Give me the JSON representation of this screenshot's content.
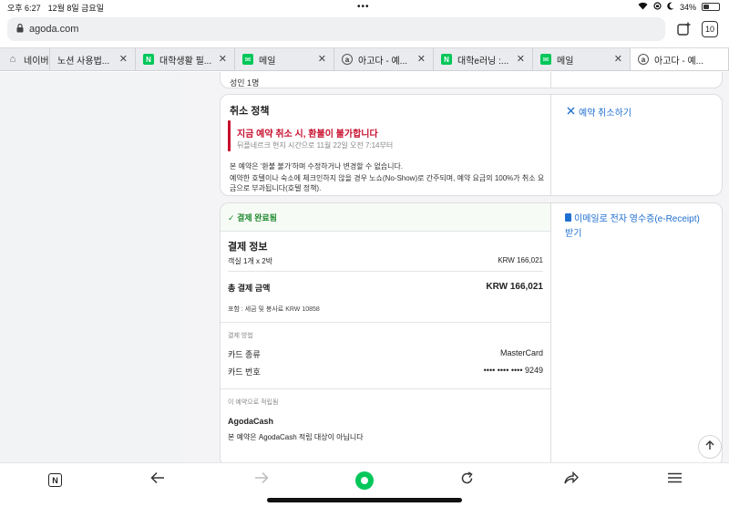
{
  "status": {
    "time": "오후 6:27",
    "date": "12월 8일 금요일",
    "dots": "•••",
    "battery": "34%"
  },
  "browser": {
    "url": "agoda.com",
    "tab_count": "10"
  },
  "tabs": [
    {
      "label": "네이버",
      "icon": "home-icon",
      "fav_color": "#666666",
      "fav_text": "⌂"
    },
    {
      "label": "노션 사용법...",
      "icon": "none",
      "fav_color": "",
      "fav_text": ""
    },
    {
      "label": "대학생활 필...",
      "icon": "naver-icon",
      "fav_color": "#03c75a",
      "fav_text": "N"
    },
    {
      "label": "메일",
      "icon": "mail-icon",
      "fav_color": "#03c75a",
      "fav_text": "✉"
    },
    {
      "label": "아고다 - 예...",
      "icon": "agoda-icon",
      "fav_color": "#555555",
      "fav_text": "a"
    },
    {
      "label": "대학e러닝 :...",
      "icon": "naver-icon",
      "fav_color": "#03c75a",
      "fav_text": "N"
    },
    {
      "label": "메일",
      "icon": "mail-icon",
      "fav_color": "#03c75a",
      "fav_text": "✉"
    },
    {
      "label": "아고다 - 예...",
      "icon": "agoda-icon",
      "fav_color": "#555555",
      "fav_text": "a"
    }
  ],
  "top_card": {
    "label": "성인 1명"
  },
  "cancel": {
    "title": "취소 정책",
    "warning": "지금 예약 취소 시, 환불이 불가합니다",
    "warning_sub": "뒤플네르크 현지 시간으로 11월 22일 오전 7:14부터",
    "note1": "본 예약은 '환불 불가'하며 수정하거나 변경할 수 없습니다.",
    "note2": "예약한 호텔이나 숙소에 체크인하지 않을 경우 노쇼(No-Show)로 간주되며, 예약 요금의 100%가 취소 요금으로 부과됩니다(호텔 정책).",
    "cancel_link": "예약 취소하기"
  },
  "payment": {
    "status": "결제 완료됨",
    "info_title": "결제 정보",
    "room_label": "객실 1개 x 2박",
    "room_value": "KRW 166,021",
    "total_label": "총 결제 금액",
    "total_value": "KRW 166,021",
    "tax_note": "포함 : 세금 및 봉사료 KRW 10858",
    "method_title": "결제 방법",
    "card_type_label": "카드 종류",
    "card_type_value": "MasterCard",
    "card_no_label": "카드 번호",
    "card_no_value": "•••• •••• •••• 9249",
    "earned_title": "이 예약으로 적립됨",
    "cash_title": "AgodaCash",
    "cash_note": "본 예약은 AgodaCash 적립 대상이 아닙니다",
    "receipt_link": "이메일로 전자 영수증(e-Receipt) 받기"
  }
}
